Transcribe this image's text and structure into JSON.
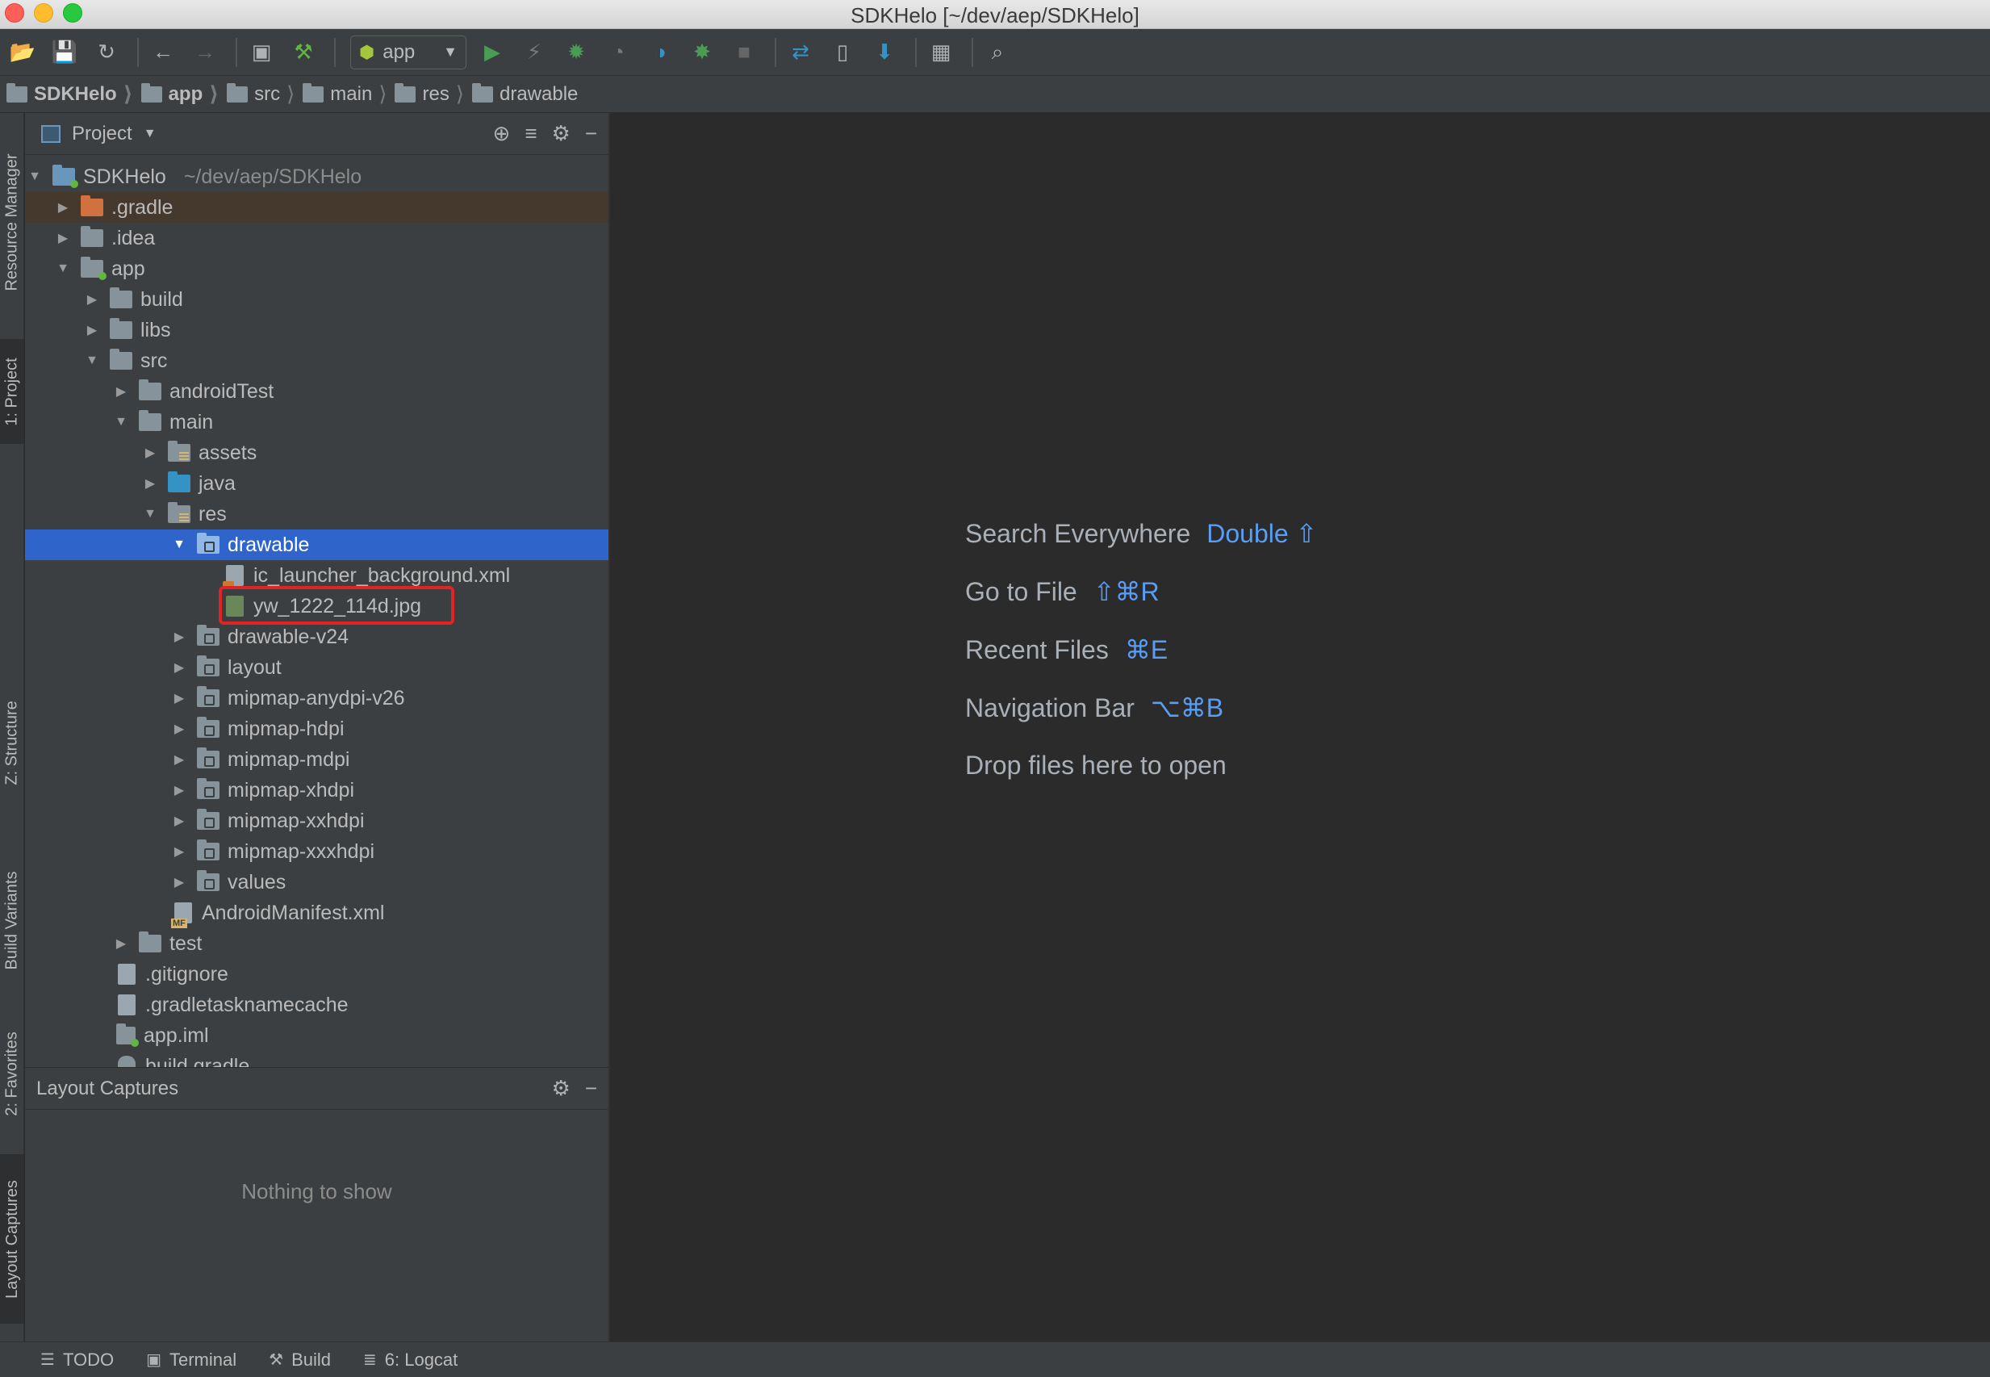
{
  "window": {
    "title": "SDKHelo [~/dev/aep/SDKHelo]"
  },
  "toolbar": {
    "run_config": "app"
  },
  "breadcrumb": [
    "SDKHelo",
    "app",
    "src",
    "main",
    "res",
    "drawable"
  ],
  "left_tabs": {
    "resource_manager": "Resource Manager",
    "project": "1: Project",
    "structure": "Z: Structure",
    "build_variants": "Build Variants",
    "favorites": "2: Favorites",
    "layout_captures": "Layout Captures"
  },
  "project_panel": {
    "title": "Project",
    "tree": [
      {
        "label": "SDKHelo",
        "path": "~/dev/aep/SDKHelo"
      },
      {
        "label": ".gradle"
      },
      {
        "label": ".idea"
      },
      {
        "label": "app"
      },
      {
        "label": "build"
      },
      {
        "label": "libs"
      },
      {
        "label": "src"
      },
      {
        "label": "androidTest"
      },
      {
        "label": "main"
      },
      {
        "label": "assets"
      },
      {
        "label": "java"
      },
      {
        "label": "res"
      },
      {
        "label": "drawable"
      },
      {
        "label": "ic_launcher_background.xml"
      },
      {
        "label": "yw_1222_114d.jpg"
      },
      {
        "label": "drawable-v24"
      },
      {
        "label": "layout"
      },
      {
        "label": "mipmap-anydpi-v26"
      },
      {
        "label": "mipmap-hdpi"
      },
      {
        "label": "mipmap-mdpi"
      },
      {
        "label": "mipmap-xhdpi"
      },
      {
        "label": "mipmap-xxhdpi"
      },
      {
        "label": "mipmap-xxxhdpi"
      },
      {
        "label": "values"
      },
      {
        "label": "AndroidManifest.xml"
      },
      {
        "label": "test"
      },
      {
        "label": ".gitignore"
      },
      {
        "label": ".gradletasknamecache"
      },
      {
        "label": "app.iml"
      },
      {
        "label": "build.gradle"
      }
    ]
  },
  "captures_panel": {
    "title": "Layout Captures",
    "empty_text": "Nothing to show"
  },
  "editor_hints": [
    {
      "label": "Search Everywhere",
      "key": "Double ⇧"
    },
    {
      "label": "Go to File",
      "key": "⇧⌘R"
    },
    {
      "label": "Recent Files",
      "key": "⌘E"
    },
    {
      "label": "Navigation Bar",
      "key": "⌥⌘B"
    },
    {
      "label": "Drop files here to open",
      "key": ""
    }
  ],
  "bottom_tabs": {
    "todo": "TODO",
    "terminal": "Terminal",
    "build": "Build",
    "logcat": "6: Logcat"
  },
  "colors": {
    "selection": "#2f65ca",
    "highlight_box": "#e02323",
    "shortcut": "#589df6"
  }
}
